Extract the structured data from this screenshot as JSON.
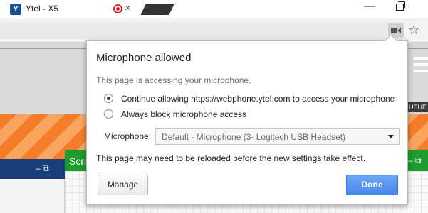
{
  "browser": {
    "tab_title": "Ytel - X5",
    "tab_favicon_letter": "Y",
    "tab_close": "×",
    "window_minimize": "—",
    "bookmark_star": "☆",
    "icons": {
      "favicon": "ytel-logo-icon",
      "recording": "recording-indicator-icon",
      "camera": "camera-permission-icon",
      "star": "bookmark-star-icon"
    }
  },
  "page": {
    "queue_label": "UEUE",
    "green_panel_title": "Scri",
    "panel_controls": "–  ⧉",
    "colors": {
      "accent_orange": "#f47d2a",
      "panel_blue": "#1b3f7a",
      "panel_green": "#1d9b2d"
    }
  },
  "bubble": {
    "title": "Microphone allowed",
    "subtitle": "This page is accessing your microphone.",
    "options": [
      {
        "label": "Continue allowing https://webphone.ytel.com to access your microphone",
        "selected": true
      },
      {
        "label": "Always block microphone access",
        "selected": false
      }
    ],
    "microphone_label": "Microphone:",
    "microphone_value": "Default - Microphone (3- Logitech USB Headset)",
    "reload_note": "This page may need to be reloaded before the new settings take effect.",
    "manage_button": "Manage",
    "done_button": "Done",
    "done_color": "#4787ed"
  }
}
